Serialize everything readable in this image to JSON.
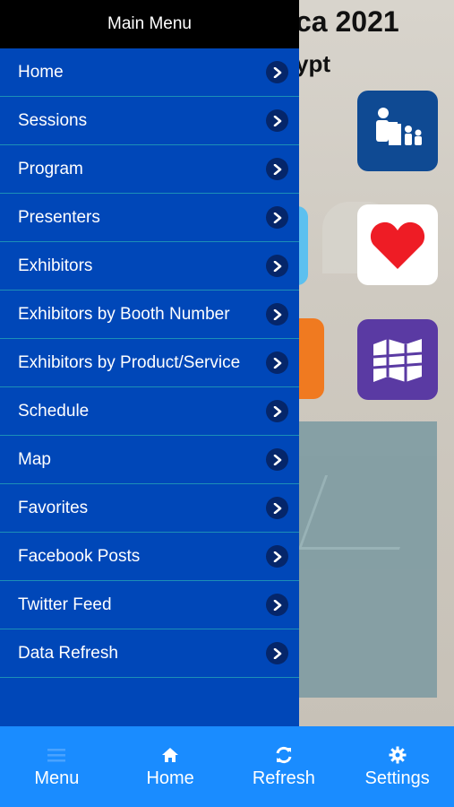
{
  "background": {
    "title": "ca 2021",
    "subtitle": "ypt",
    "tiles": [
      {
        "name": "sessions-tile",
        "icon": "presenter-icon",
        "color": "#0f4a93"
      },
      {
        "name": "favorites-tile",
        "icon": "heart-icon",
        "color": "#ffffff"
      },
      {
        "name": "map-tile",
        "icon": "map-icon",
        "color": "#5a3aa3"
      }
    ]
  },
  "drawer": {
    "title": "Main Menu",
    "items": [
      {
        "label": "Home"
      },
      {
        "label": "Sessions"
      },
      {
        "label": "Program"
      },
      {
        "label": "Presenters"
      },
      {
        "label": "Exhibitors"
      },
      {
        "label": "Exhibitors by Booth Number"
      },
      {
        "label": "Exhibitors by Product/Service"
      },
      {
        "label": "Schedule"
      },
      {
        "label": "Map"
      },
      {
        "label": "Favorites"
      },
      {
        "label": "Facebook Posts"
      },
      {
        "label": "Twitter Feed"
      },
      {
        "label": "Data Refresh"
      }
    ]
  },
  "bottom_bar": {
    "tabs": [
      {
        "label": "Menu",
        "icon": "hamburger-icon"
      },
      {
        "label": "Home",
        "icon": "home-icon"
      },
      {
        "label": "Refresh",
        "icon": "refresh-icon"
      },
      {
        "label": "Settings",
        "icon": "gear-icon"
      }
    ]
  },
  "colors": {
    "drawer_bg": "#0047b8",
    "drawer_header_bg": "#000000",
    "bottom_bar_bg": "#1a8cff",
    "chevron_bg": "#05266a"
  }
}
